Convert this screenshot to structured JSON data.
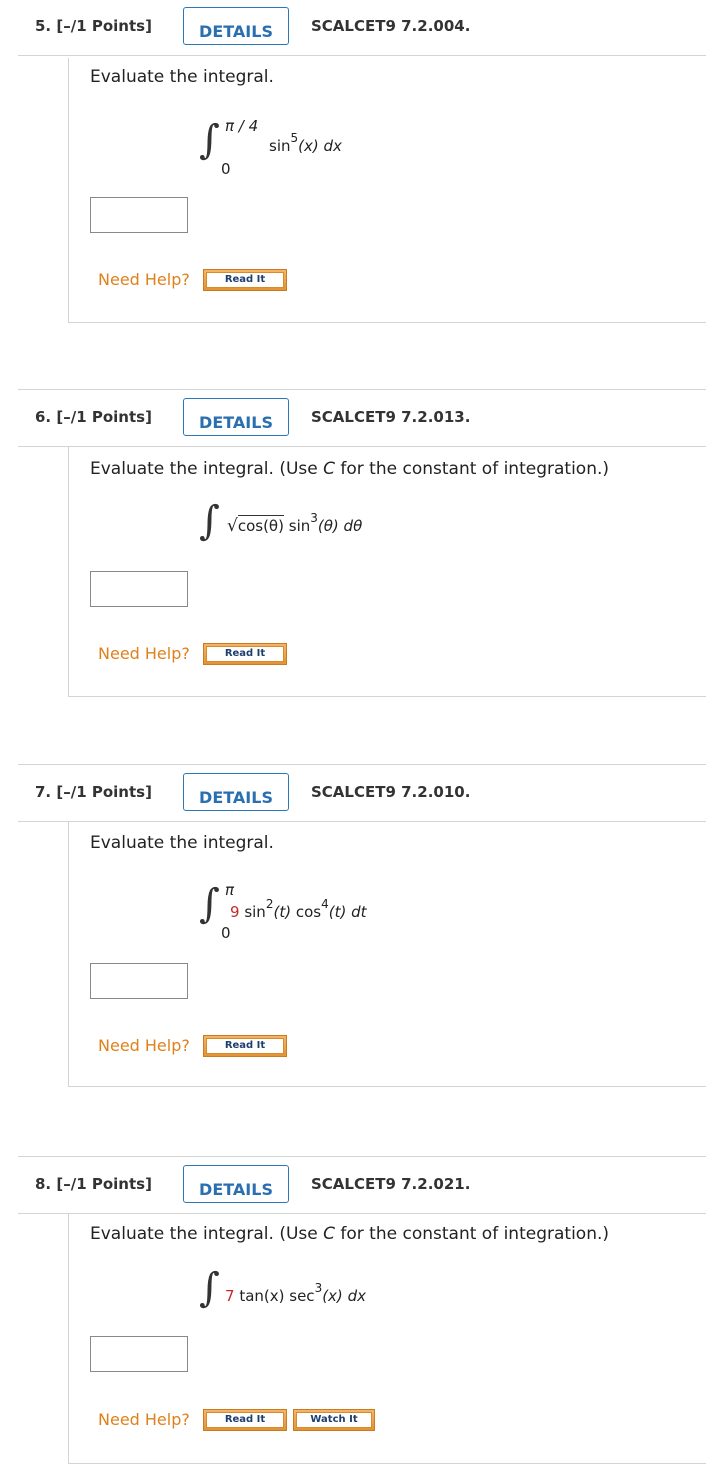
{
  "questions": [
    {
      "number": "5.",
      "points": "[–/1 Points]",
      "details_label": "DETAILS",
      "qid": "SCALCET9 7.2.004.",
      "prompt": "Evaluate the integral.",
      "upper_limit": "π / 4",
      "lower_limit": "0",
      "integrand": {
        "func": "sin",
        "power": "5",
        "arg": "(x) ",
        "diff": "dx"
      },
      "answer_value": "",
      "need_help": "Need Help?",
      "read_it": "Read It"
    },
    {
      "number": "6.",
      "points": "[–/1 Points]",
      "details_label": "DETAILS",
      "qid": "SCALCET9 7.2.013.",
      "prompt_before": "Evaluate the integral. (Use ",
      "prompt_var": "C",
      "prompt_after": " for the constant of integration.)",
      "integrand": {
        "sqrt_content": "cos(θ)",
        "func": "sin",
        "power": "3",
        "arg": "(θ) ",
        "diff": "dθ"
      },
      "answer_value": "",
      "need_help": "Need Help?",
      "read_it": "Read It"
    },
    {
      "number": "7.",
      "points": "[–/1 Points]",
      "details_label": "DETAILS",
      "qid": "SCALCET9 7.2.010.",
      "prompt": "Evaluate the integral.",
      "upper_limit": "π",
      "lower_limit": "0",
      "integrand": {
        "coef": "9",
        "func1": "sin",
        "power1": "2",
        "arg1": "(t) ",
        "func2": "cos",
        "power2": "4",
        "arg2": "(t) ",
        "diff": "dt"
      },
      "answer_value": "",
      "need_help": "Need Help?",
      "read_it": "Read It"
    },
    {
      "number": "8.",
      "points": "[–/1 Points]",
      "details_label": "DETAILS",
      "qid": "SCALCET9 7.2.021.",
      "prompt_before": "Evaluate the integral. (Use ",
      "prompt_var": "C",
      "prompt_after": " for the constant of integration.)",
      "integrand": {
        "coef": "7",
        "func1": "tan(x) ",
        "func2": "sec",
        "power2": "3",
        "arg2": "(x) ",
        "diff": "dx"
      },
      "answer_value": "",
      "need_help": "Need Help?",
      "read_it": "Read It",
      "watch_it": "Watch It"
    }
  ],
  "colors": {
    "details_blue": "#2a78b8",
    "help_orange": "#e0801a",
    "coef_red": "#c62828"
  }
}
